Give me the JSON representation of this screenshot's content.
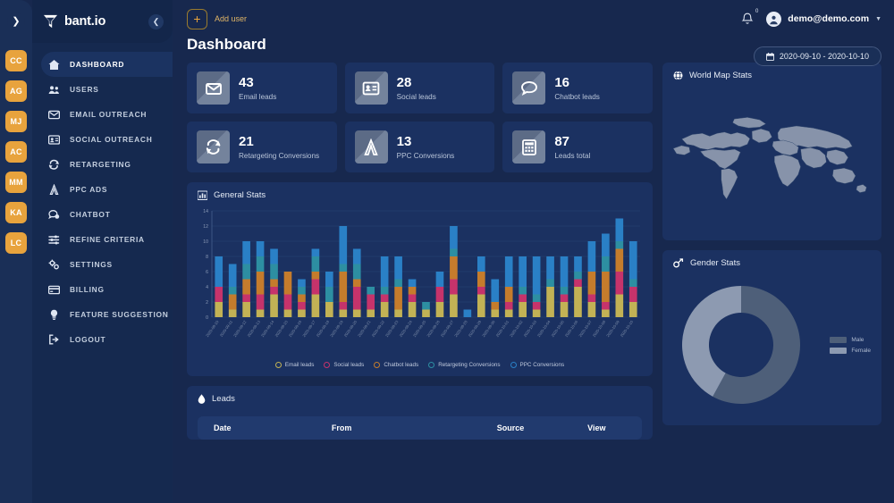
{
  "brand": {
    "name": "bant.io",
    "logo_icon": "funnel-icon"
  },
  "rail": {
    "expand_icon": "chevron-right-icon",
    "avatars": [
      {
        "initials": "CC"
      },
      {
        "initials": "AG"
      },
      {
        "initials": "MJ"
      },
      {
        "initials": "AC"
      },
      {
        "initials": "MM"
      },
      {
        "initials": "KA"
      },
      {
        "initials": "LC"
      }
    ],
    "avatar_color": "#e8a33d"
  },
  "sidebar": {
    "collapse_icon": "chevron-left-icon",
    "items": [
      {
        "label": "DASHBOARD",
        "icon": "home-icon",
        "active": true
      },
      {
        "label": "USERS",
        "icon": "users-icon",
        "active": false
      },
      {
        "label": "EMAIL OUTREACH",
        "icon": "envelope-icon",
        "active": false
      },
      {
        "label": "SOCIAL OUTREACH",
        "icon": "id-card-icon",
        "active": false
      },
      {
        "label": "RETARGETING",
        "icon": "refresh-icon",
        "active": false
      },
      {
        "label": "PPC ADS",
        "icon": "adwords-icon",
        "active": false
      },
      {
        "label": "CHATBOT",
        "icon": "chat-icon",
        "active": false
      },
      {
        "label": "REFINE CRITERIA",
        "icon": "sliders-icon",
        "active": false
      },
      {
        "label": "SETTINGS",
        "icon": "gear-icon",
        "active": false
      },
      {
        "label": "BILLING",
        "icon": "credit-card-icon",
        "active": false
      },
      {
        "label": "FEATURE SUGGESTION",
        "icon": "lightbulb-icon",
        "active": false
      },
      {
        "label": "LOGOUT",
        "icon": "logout-icon",
        "active": false
      }
    ]
  },
  "topbar": {
    "add_user_label": "Add user",
    "add_user_icon": "plus-icon",
    "bell_icon": "bell-icon",
    "notification_count": "0",
    "user_email": "demo@demo.com",
    "user_icon": "user-avatar-icon",
    "caret_icon": "chevron-down-icon"
  },
  "page_title": "Dashboard",
  "date_range": {
    "value": "2020-09-10 - 2020-10-10",
    "icon": "calendar-icon"
  },
  "cards": [
    {
      "value": "43",
      "label": "Email leads",
      "icon": "envelope-icon"
    },
    {
      "value": "28",
      "label": "Social leads",
      "icon": "id-card-icon"
    },
    {
      "value": "16",
      "label": "Chatbot leads",
      "icon": "chat-bubble-icon"
    },
    {
      "value": "21",
      "label": "Retargeting Conversions",
      "icon": "refresh-icon"
    },
    {
      "value": "13",
      "label": "PPC Conversions",
      "icon": "adwords-icon"
    },
    {
      "value": "87",
      "label": "Leads total",
      "icon": "calculator-icon"
    }
  ],
  "general_stats": {
    "title": "General Stats",
    "icon": "bar-chart-icon"
  },
  "leads": {
    "title": "Leads",
    "icon": "drop-icon",
    "columns": [
      "Date",
      "From",
      "Source",
      "View"
    ]
  },
  "world_map": {
    "title": "World Map Stats",
    "icon": "globe-icon"
  },
  "gender": {
    "title": "Gender Stats",
    "icon": "gender-icon",
    "legend": [
      {
        "label": "Male",
        "color": "#4e5f79"
      },
      {
        "label": "Female",
        "color": "#8d9ab1"
      }
    ]
  },
  "chart_data": {
    "type": "bar",
    "title": "General Stats",
    "stacked": true,
    "xlabel": "",
    "ylabel": "",
    "ylim": [
      0,
      14
    ],
    "yticks": [
      0,
      2,
      4,
      6,
      8,
      10,
      12,
      14
    ],
    "grid": true,
    "legend_position": "bottom",
    "colors": {
      "Email leads": "#c2b255",
      "Social leads": "#c6336b",
      "Chatbot leads": "#c57c2c",
      "Retargeting Conversions": "#2d8fa2",
      "PPC Conversions": "#2a80c6"
    },
    "categories": [
      "2020-09-10",
      "2020-09-11",
      "2020-09-12",
      "2020-09-13",
      "2020-09-14",
      "2020-09-15",
      "2020-09-16",
      "2020-09-17",
      "2020-09-18",
      "2020-09-19",
      "2020-09-20",
      "2020-09-21",
      "2020-09-22",
      "2020-09-23",
      "2020-09-24",
      "2020-09-25",
      "2020-09-26",
      "2020-09-27",
      "2020-09-28",
      "2020-09-29",
      "2020-09-30",
      "2020-10-01",
      "2020-10-02",
      "2020-10-03",
      "2020-10-04",
      "2020-10-05",
      "2020-10-06",
      "2020-10-07",
      "2020-10-08",
      "2020-10-09",
      "2020-10-10"
    ],
    "series": [
      {
        "name": "Email leads",
        "values": [
          2,
          1,
          2,
          1,
          3,
          1,
          1,
          3,
          2,
          1,
          1,
          1,
          2,
          1,
          2,
          1,
          2,
          3,
          0,
          3,
          1,
          1,
          2,
          1,
          4,
          2,
          4,
          2,
          1,
          3,
          2
        ]
      },
      {
        "name": "Social leads",
        "values": [
          2,
          0,
          1,
          2,
          1,
          2,
          1,
          2,
          0,
          1,
          3,
          2,
          1,
          0,
          1,
          0,
          2,
          2,
          0,
          1,
          0,
          1,
          1,
          1,
          0,
          1,
          1,
          1,
          1,
          3,
          2
        ]
      },
      {
        "name": "Chatbot leads",
        "values": [
          0,
          2,
          2,
          3,
          1,
          3,
          1,
          1,
          0,
          4,
          1,
          0,
          0,
          3,
          1,
          0,
          0,
          3,
          0,
          2,
          1,
          2,
          0,
          0,
          0,
          0,
          0,
          3,
          4,
          3,
          0
        ]
      },
      {
        "name": "Retargeting Conversions",
        "values": [
          0,
          1,
          2,
          2,
          2,
          0,
          1,
          2,
          2,
          1,
          2,
          1,
          1,
          1,
          0,
          1,
          0,
          1,
          0,
          0,
          0,
          0,
          1,
          1,
          1,
          1,
          1,
          0,
          2,
          1,
          1
        ]
      },
      {
        "name": "PPC Conversions",
        "values": [
          4,
          3,
          3,
          2,
          2,
          0,
          1,
          1,
          2,
          5,
          2,
          0,
          4,
          3,
          1,
          0,
          2,
          3,
          1,
          2,
          3,
          4,
          4,
          5,
          3,
          4,
          2,
          4,
          3,
          3,
          5
        ]
      }
    ]
  },
  "gender_data": {
    "type": "pie",
    "title": "Gender Stats",
    "labels": [
      "Male",
      "Female"
    ],
    "values": [
      58,
      42
    ],
    "colors": [
      "#4e5f79",
      "#8d9ab1"
    ]
  }
}
